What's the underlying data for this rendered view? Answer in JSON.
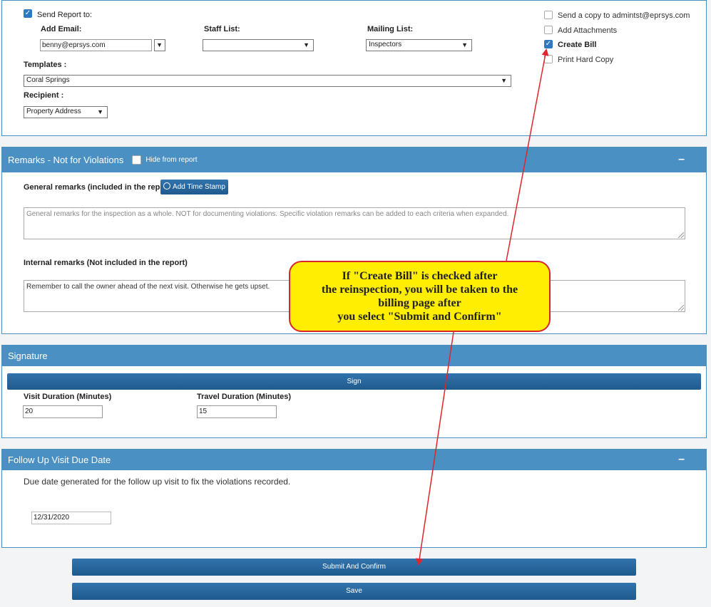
{
  "report": {
    "send_report_label": "Send Report to:",
    "add_email_label": "Add Email:",
    "add_email_value": "benny@eprsys.com",
    "staff_list_label": "Staff List:",
    "staff_list_value": "",
    "mailing_list_label": "Mailing List:",
    "mailing_list_value": "Inspectors",
    "templates_label": "Templates :",
    "templates_value": "Coral Springs",
    "recipient_label": "Recipient :",
    "recipient_value": "Property Address",
    "send_copy_label": "Send a copy to admintst@eprsys.com",
    "add_attachments_label": "Add Attachments",
    "create_bill_label": "Create Bill",
    "print_hard_copy_label": "Print Hard Copy"
  },
  "remarks": {
    "title": "Remarks - Not for Violations",
    "hide_label": "Hide from report",
    "general_label": "General remarks (included in the report)",
    "time_stamp_label": "Add Time Stamp",
    "general_placeholder": "General remarks for the inspection as a whole. NOT for documenting violations. Specific violation remarks can be added to each criteria when expanded.",
    "internal_label": "Internal remarks (Not included in the report)",
    "internal_value": "Remember to call the owner ahead of the next visit. Otherwise he gets upset."
  },
  "signature": {
    "title": "Signature",
    "sign_label": "Sign",
    "visit_duration_label": "Visit Duration (Minutes)",
    "visit_duration_value": "20",
    "travel_duration_label": "Travel Duration (Minutes)",
    "travel_duration_value": "15"
  },
  "follow_up": {
    "title": "Follow Up Visit Due Date",
    "description": "Due date generated for the follow up visit to fix the violations recorded.",
    "date_value": "12/31/2020"
  },
  "actions": {
    "submit_label": "Submit And Confirm",
    "save_label": "Save"
  },
  "callout": {
    "line1": "If \"Create Bill\" is checked after",
    "line2": "the reinspection, you will be taken to the",
    "line3": "billing page after",
    "line4": "you select \"Submit and Confirm\""
  },
  "colors": {
    "header_blue": "#4a90c2",
    "button_blue": "#2a6aa3",
    "callout_fill": "#ffee00",
    "arrow_red": "#e0252b"
  },
  "icons": {
    "check": "check-icon",
    "dropdown": "chevron-down-icon",
    "collapse": "minus-icon",
    "clock": "clock-icon"
  }
}
